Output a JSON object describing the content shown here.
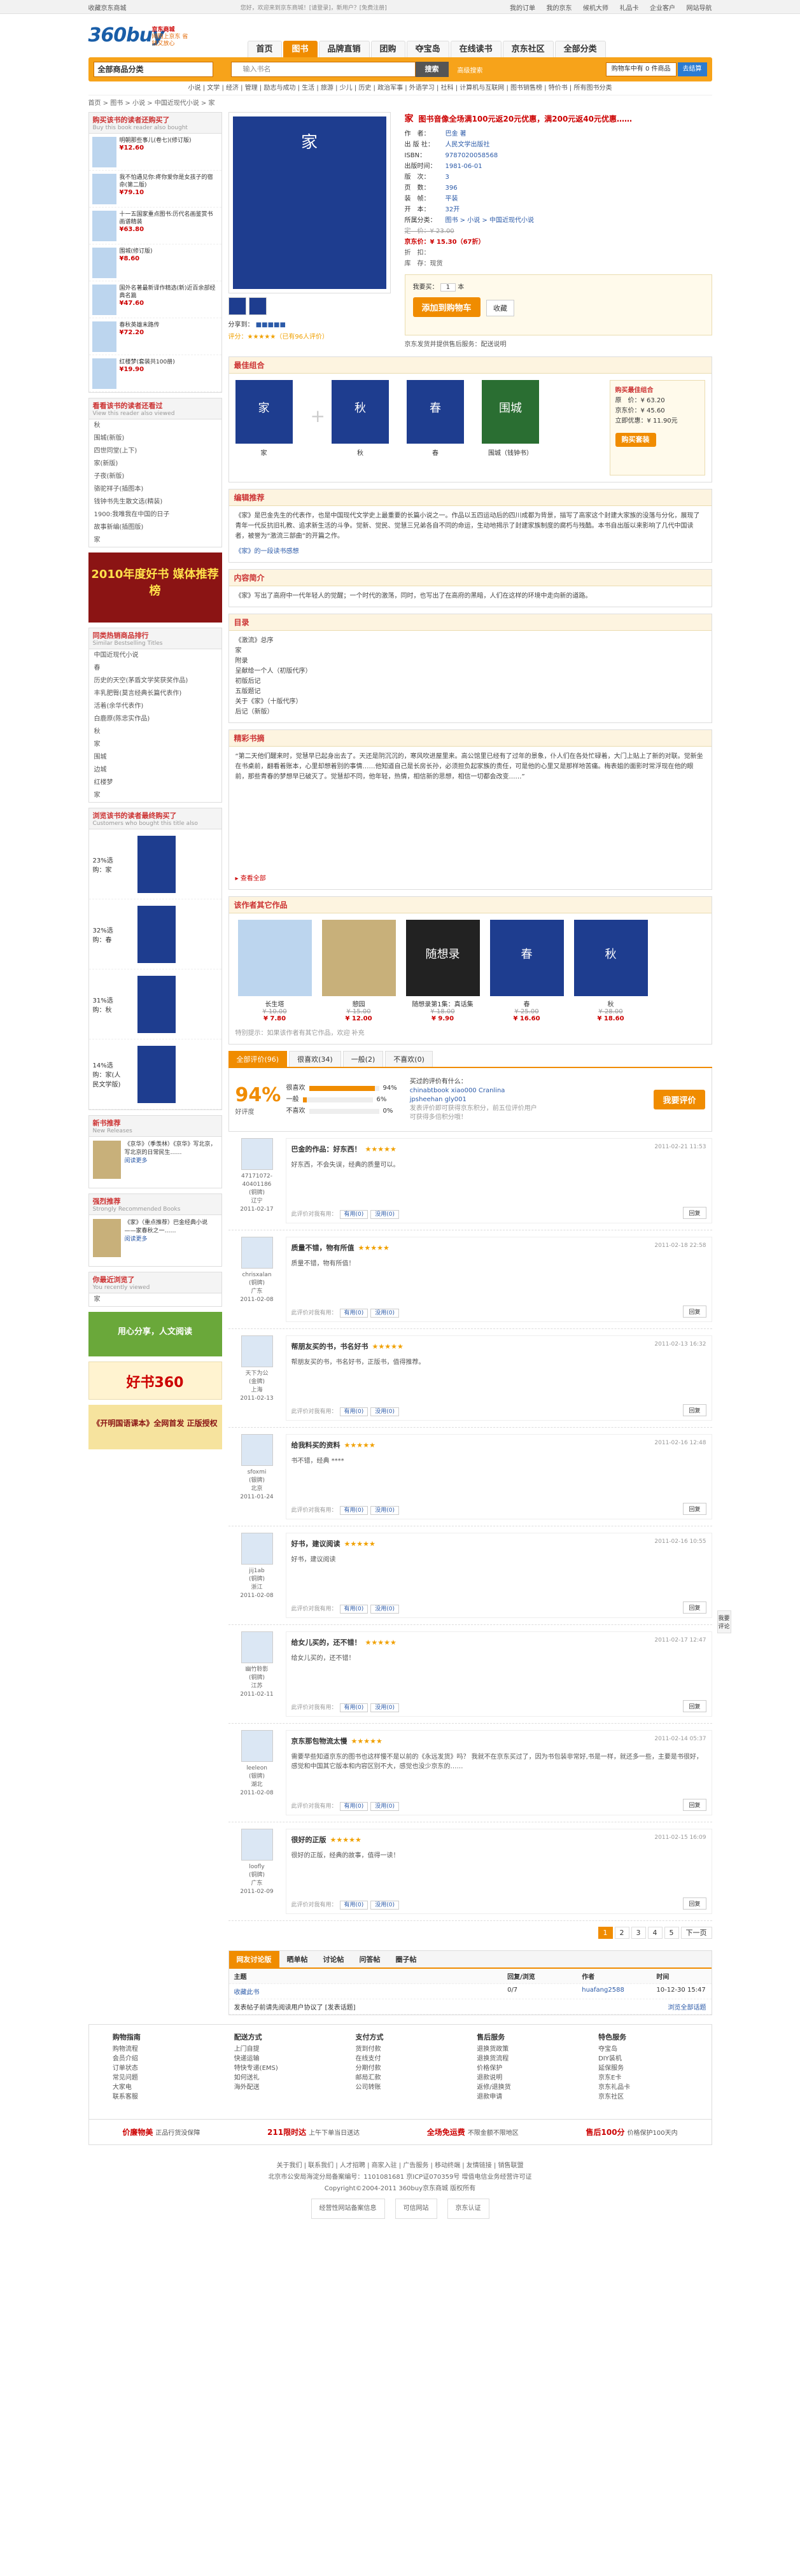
{
  "topbar": {
    "left": "收藏京东商城",
    "greet": "您好，欢迎来到京东商城！[请登录]，新用户？[免费注册]",
    "links": [
      "我的订单",
      "我的京东",
      "候机大师",
      "礼品卡",
      "企业客户",
      "网站导航"
    ]
  },
  "logo": {
    "text": "360buy",
    "cn": "京东商城",
    "tag": "网购上京东 省钱又放心"
  },
  "nav": [
    "首页",
    "图书",
    "品牌直销",
    "团购",
    "夺宝岛",
    "在线读书",
    "京东社区",
    "全部分类"
  ],
  "search": {
    "category": "全部商品分类",
    "placeholder": "输入书名",
    "button": "搜索",
    "advanced": "高级搜索",
    "cart": "购物车中有 0 件商品",
    "checkout": "去结算"
  },
  "subnav": "小说 | 文学 | 经济 | 管理 | 励志与成功 | 生活 | 旅游 | 少儿 | 历史 | 政治军事 | 外语学习 | 社科 | 计算机与互联网 | 图书销售榜 | 特价书 | 所有图书分类",
  "crumb": "首页 > 图书 > 小说 > 中国近现代小说 > 家",
  "left": {
    "bought": {
      "title": "购买该书的读者还购买了",
      "en": "Buy this book reader also bought",
      "items": [
        {
          "name": "明朝那些事儿(卷七)(修订版)",
          "price": "¥12.60"
        },
        {
          "name": "我不怕遇见你:疼你爱你是女孩子的宿命(第二版)",
          "price": "¥79.10"
        },
        {
          "name": "十一五国家重点图书:历代名画鉴赏书画谱精装",
          "price": "¥63.80"
        },
        {
          "name": "围城(修订版)",
          "price": "¥8.60"
        },
        {
          "name": "国外名著最新译作精选(新)近百余部经典名篇",
          "price": "¥47.60"
        },
        {
          "name": "春秋英雄末路传",
          "price": "¥72.20"
        },
        {
          "name": "红楼梦(套装共100册)",
          "price": "¥19.90"
        }
      ]
    },
    "viewed": {
      "title": "看看该书的读者还看过",
      "en": "View this reader also viewed",
      "items": [
        "秋",
        "围城(新版)",
        "四世同堂(上下)",
        "家(新版)",
        "子夜(新版)",
        "骆驼祥子(插图本)",
        "钱钟书先生散文选(精装)",
        "1900:我唯我在中国的日子",
        "故事新编(插图版)",
        "家 "
      ]
    },
    "ad": "2010年度好书 媒体推荐榜",
    "samecat": {
      "title": "同类热销商品排行",
      "en": "Similar Bestselling Titles",
      "items": [
        "中国近现代小说",
        "春",
        "历史的天空(茅盾文学奖获奖作品)",
        "丰乳肥臀(莫言经典长篇代表作)",
        "活着(余华代表作)",
        "白鹿原(陈忠实作品)",
        "秋",
        "家",
        "围城",
        "边城",
        "红楼梦",
        "家 "
      ]
    },
    "finalbuy": {
      "title": "浏览该书的读者最终购买了",
      "en": "Customers who bought this title also",
      "items": [
        {
          "pct": "23%",
          "label": "选购：家"
        },
        {
          "pct": "32%",
          "label": "选购：春"
        },
        {
          "pct": "31%",
          "label": "选购：秋"
        },
        {
          "pct": "14%",
          "label": "选购：家(人民文学版)"
        }
      ]
    },
    "newbook": {
      "title": "新书推荐",
      "en": "New Releases",
      "text": "《京华》（季羡林）《京华》写北京，写北京的日常民生……",
      "more": "阅读更多"
    },
    "recommend": {
      "title": "强烈推荐",
      "en": "Strongly Recommended Books",
      "text": "《家》（重点推荐）巴金经典小说——家春秋之一……",
      "more": "阅读更多"
    },
    "recent": {
      "title": "你最近浏览了",
      "en": "You recently viewed",
      "item": "家"
    },
    "ad2": "用心分享，人文阅读",
    "ad3": "好书360",
    "ad4": "《开明国语课本》全网首发 正版授权"
  },
  "product": {
    "cover": "家",
    "title": "家",
    "slogan": "图书音像全场满100元返20元优惠，满200元返40元优惠……",
    "fields": [
      {
        "k": "作　者：",
        "v": "巴金 著"
      },
      {
        "k": "出 版 社：",
        "v": "人民文学出版社"
      },
      {
        "k": "ISBN：",
        "v": "9787020058568"
      },
      {
        "k": "出版时间：",
        "v": "1981-06-01"
      },
      {
        "k": "版　次：",
        "v": "3"
      },
      {
        "k": "页　数：",
        "v": "396"
      },
      {
        "k": "装　帧：",
        "v": "平装"
      },
      {
        "k": "开　本：",
        "v": "32开"
      },
      {
        "k": "所属分类：",
        "v": "图书 > 小说 > 中国近现代小说"
      }
    ],
    "list_price": "定　价：¥ 23.00",
    "jd_price": "京东价：¥ 15.30（67折）",
    "discount": "折　扣：",
    "stock": "库　存：现货",
    "share": "分享到：",
    "rating": "评分：★★★★★（已有96人评价）",
    "qty_label": "我要买：",
    "qty": "1",
    "qty_unit": "本",
    "buy": "添加到购物车",
    "fav": "收藏",
    "ship_note": "京东发货并提供售后服务：配送说明",
    "thumbs": [
      "thumb1",
      "thumb2"
    ]
  },
  "combo": {
    "title": "最佳组合",
    "items": [
      {
        "name": "家",
        "cover": "家"
      },
      {
        "name": "秋",
        "cover": "秋"
      },
      {
        "name": "春",
        "cover": "春"
      },
      {
        "name": "围城（钱钟书）",
        "cover": "围城"
      }
    ],
    "box": {
      "title": "购买最佳组合",
      "lines": [
        "原　价：¥ 63.20",
        "京东价：¥ 45.60",
        "立即优惠：¥ 11.90元"
      ],
      "btn": "购买套装"
    }
  },
  "intro": {
    "title": "编辑推荐",
    "body": "《家》是巴金先生的代表作，也是中国现代文学史上最重要的长篇小说之一。作品以五四运动后的四川成都为背景，描写了高家这个封建大家族的没落与分化，展现了青年一代反抗旧礼教、追求新生活的斗争。觉新、觉民、觉慧三兄弟各自不同的命运，生动地揭示了封建家族制度的腐朽与残酷。本书自出版以来影响了几代中国读者，被誉为“激流三部曲”的开篇之作。",
    "links": "《家》的一段读书感想"
  },
  "content": {
    "title": "内容简介",
    "body": "《家》写出了高府中一代年轻人的觉醒；一个时代的激荡，同时，也写出了在高府的黑暗，人们在这样的环境中走向新的道路。"
  },
  "toc": {
    "title": "目录",
    "items": [
      "《激流》总序",
      "家",
      "附录",
      "呈献给一个人（初版代序）",
      "初版后记",
      "五版题记",
      "关于《家》（十版代序）",
      "后记（新版）"
    ]
  },
  "excerpt": {
    "title": "精彩书摘",
    "body": "“第二天他们醒来时，觉慧早已起身出去了。天还是阴沉沉的，寒风吹进屋里来。高公馆里已经有了过年的景象，仆人们在各处忙碌着，大门上贴上了新的对联。觉新坐在书桌前，翻看着账本，心里却想着别的事情……他知道自己是长房长孙，必须担负起家族的责任，可是他的心里又是那样地苦痛。梅表姐的面影时常浮现在他的眼前，那些青春的梦想早已破灭了。觉慧却不同，他年轻，热情，相信新的思想，相信一切都会改变……”",
    "more": "▸ 查看全部"
  },
  "related": {
    "title": "该作者其它作品",
    "items": [
      {
        "name": "长生塔",
        "old": "¥ 10.00",
        "price": "¥ 7.80",
        "cover": ""
      },
      {
        "name": "憩园",
        "old": "¥ 15.00",
        "price": "¥ 12.00",
        "cover": ""
      },
      {
        "name": "随想录第1集：真话集",
        "old": "¥ 18.00",
        "price": "¥ 9.90",
        "cover": "随想录"
      },
      {
        "name": "春",
        "old": "¥ 25.00",
        "price": "¥ 16.60",
        "cover": "春"
      },
      {
        "name": "秋",
        "old": "¥ 28.00",
        "price": "¥ 18.60",
        "cover": "秋"
      }
    ],
    "note": "特别提示：如果该作者有其它作品，欢迎 补充"
  },
  "reviews": {
    "tabs": [
      "全部评价(96)",
      "很喜欢(34)",
      "一般(2)",
      "不喜欢(0)"
    ],
    "score": "94%",
    "score_label": "好评度",
    "bars": [
      {
        "label": "很喜欢",
        "pct": "94%",
        "v": 94
      },
      {
        "label": "一般",
        "pct": "6%",
        "v": 6
      },
      {
        "label": "不喜欢",
        "pct": "0%",
        "v": 0
      }
    ],
    "tags_title": "买过的评价有什么：",
    "tags": "chinabtbook  xiao000  Cranlina  jpsheehan  gly001",
    "write_note": "发表评价即可获得京东积分，前五位评价用户可获得多倍积分哦！",
    "write_btn": "我要评价",
    "items": [
      {
        "user": "47171072-40401186",
        "lvl": "(铜牌)",
        "loc": "辽宁",
        "date": "2011-02-17",
        "title": "巴金的作品：好东西！",
        "stars": "★★★★★",
        "time": "2011-02-21 11:53",
        "body": "好东西，不会失误，经典的质量可以。"
      },
      {
        "user": "chrisxalan",
        "lvl": "(铜牌)",
        "loc": "广东",
        "date": "2011-02-08",
        "title": "质量不错，物有所值",
        "stars": "★★★★★",
        "time": "2011-02-18 22:58",
        "body": "质量不错，物有所值！"
      },
      {
        "user": "天下为公",
        "lvl": "(金牌)",
        "loc": "上海",
        "date": "2011-02-13",
        "title": "帮朋友买的书，书名好书",
        "stars": "★★★★★",
        "time": "2011-02-13 16:32",
        "body": "帮朋友买的书，书名好书，正版书，值得推荐。"
      },
      {
        "user": "sfoxmi",
        "lvl": "(银牌)",
        "loc": "北京",
        "date": "2011-01-24",
        "title": "给我料买的资料",
        "stars": "★★★★★",
        "time": "2011-02-16 12:48",
        "body": "书不错，经典 ****"
      },
      {
        "user": "jij1ab",
        "lvl": "(铜牌)",
        "loc": "浙江",
        "date": "2011-02-08",
        "title": "好书，建议阅读",
        "stars": "★★★★★",
        "time": "2011-02-16 10:55",
        "body": "好书，建议阅读"
      },
      {
        "user": "幽竹聆影",
        "lvl": "(铜牌)",
        "loc": "江苏",
        "date": "2011-02-11",
        "title": "给女儿买的，还不错！",
        "stars": "★★★★★",
        "time": "2011-02-17 12:47",
        "body": "给女儿买的，还不错！"
      },
      {
        "user": "leeleon",
        "lvl": "(银牌)",
        "loc": "湖北",
        "date": "2011-02-08",
        "title": "京东那包物流太慢",
        "stars": "★★★★★",
        "time": "2011-02-14 05:37",
        "body": "需要早些知道京东的图书也这样慢不是以前的《永远发货》吗？ 我就不在京东买过了，因为书包装非常好,书是一样，就还多一些，主要是书很好，感觉和中国其它版本和内容区别不大，感觉也没少京东的……"
      },
      {
        "user": "loofly",
        "lvl": "(铜牌)",
        "loc": "广东",
        "date": "2011-02-09",
        "title": "很好的正版",
        "stars": "★★★★★",
        "time": "2011-02-15 16:09",
        "body": "很好的正版，经典的故事，值得一读！"
      }
    ],
    "useful": "此评价对我有用：",
    "yes": "有用(0)",
    "no": "没用(0)",
    "reply": "回复",
    "pager": [
      "1",
      "2",
      "3",
      "4",
      "5",
      "下一页"
    ]
  },
  "forum": {
    "tabs": [
      "网友讨论版",
      "晒单帖",
      "讨论帖",
      "问答帖",
      "圈子帖"
    ],
    "head": [
      "主题",
      "回复/浏览",
      "作者",
      "时间"
    ],
    "rows": [
      {
        "t": "收藏此书",
        "r": "0/7",
        "a": "huafang2588",
        "d": "10-12-30 15:47"
      }
    ],
    "note": "发表帖子前请先阅读用户协议了 [发表话题]",
    "more": "浏览全部话题"
  },
  "service": [
    {
      "t": "购物指南",
      "items": [
        "购物流程",
        "会员介绍",
        "订单状态",
        "常见问题",
        "大家电",
        "联系客服"
      ]
    },
    {
      "t": "配送方式",
      "items": [
        "上门自提",
        "快递运输",
        "特快专递(EMS)",
        "如何送礼",
        "海外配送"
      ]
    },
    {
      "t": "支付方式",
      "items": [
        "货到付款",
        "在线支付",
        "分期付款",
        "邮局汇款",
        "公司转账"
      ]
    },
    {
      "t": "售后服务",
      "items": [
        "退换货政策",
        "退换货流程",
        "价格保护",
        "退款说明",
        "返修/退换货",
        "退款申请"
      ]
    },
    {
      "t": "特色服务",
      "items": [
        "夺宝岛",
        "DIY装机",
        "延保服务",
        "京东E卡",
        "京东礼品卡",
        "京东社区"
      ]
    }
  ],
  "promise": [
    {
      "b": "价廉物美",
      "t": "正品行货没保障"
    },
    {
      "b": "211限时达",
      "t": "上午下单当日送达"
    },
    {
      "b": "全场免运费",
      "t": "不限金额不限地区"
    },
    {
      "b": "售后100分",
      "t": "价格保护100天内"
    }
  ],
  "footer": {
    "links": "关于我们 | 联系我们 | 人才招聘 | 商家入驻 | 广告服务 | 移动终端 | 友情链接 | 销售联盟",
    "icp": "北京市公安局海淀分局备案编号：1101081681 京ICP证070359号 增值电信业务经营许可证",
    "copy": "Copyright©2004-2011 360buy京东商城 版权所有",
    "badges": [
      "经营性网站备案信息",
      "可信网站",
      "京东认证"
    ]
  },
  "side": "我要评论"
}
